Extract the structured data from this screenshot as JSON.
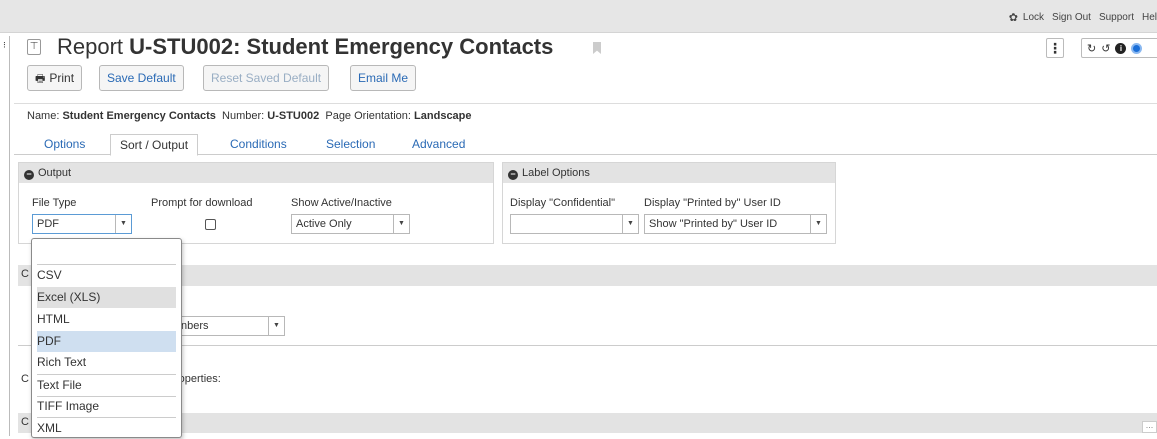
{
  "topbar": {
    "links": [
      "Lock",
      "Sign Out",
      "Support",
      "Hel"
    ]
  },
  "header": {
    "title_prefix": "Report",
    "title_bold": "U-STU002: Student Emergency Contacts",
    "kebab": "⋮"
  },
  "toolbar": {
    "print": "Print",
    "save_default": "Save Default",
    "reset_saved_default": "Reset Saved Default",
    "email_me": "Email Me"
  },
  "info": {
    "name_label": "Name:",
    "name_value": "Student Emergency Contacts",
    "number_label": "Number:",
    "number_value": "U-STU002",
    "orientation_label": "Page Orientation:",
    "orientation_value": "Landscape"
  },
  "tabs": [
    "Options",
    "Sort / Output",
    "Conditions",
    "Selection",
    "Advanced"
  ],
  "output_panel": {
    "title": "Output",
    "file_type_label": "File Type",
    "file_type_value": "PDF",
    "prompt_label": "Prompt for download",
    "prompt_checked": false,
    "show_label": "Show Active/Inactive",
    "show_value": "Active Only"
  },
  "label_panel": {
    "title": "Label Options",
    "confidential_label": "Display \"Confidential\"",
    "confidential_value": "",
    "printed_by_label": "Display \"Printed by\" User ID",
    "printed_by_value": "Show \"Printed by\" User ID"
  },
  "behind": {
    "partial_select": "nbers",
    "partial_text": "roperties:"
  },
  "dropdown": {
    "items": [
      "",
      "CSV",
      "Excel (XLS)",
      "HTML",
      "PDF",
      "Rich Text",
      "Text File",
      "TIFF Image",
      "XML"
    ],
    "hovered": "Excel (XLS)",
    "selected": "PDF"
  },
  "colors": {
    "link_blue": "#2a6ab5",
    "selected_bg": "#cfdff0",
    "hover_bg": "#e0e0e0",
    "panel_header": "#e3e3e3"
  }
}
